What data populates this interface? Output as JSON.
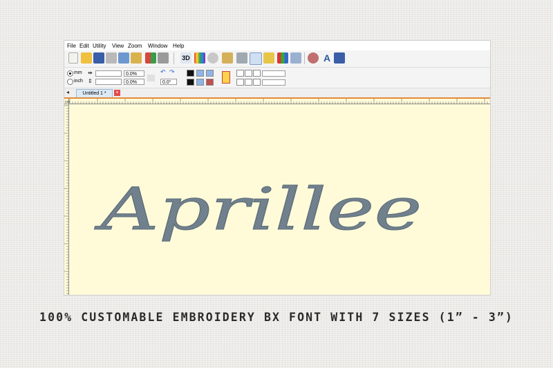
{
  "menu": [
    "File",
    "Edit",
    "Utility",
    "View",
    "Zoom",
    "Window",
    "Help"
  ],
  "toolbar": {
    "icons": [
      "new-icon",
      "open-icon",
      "save-icon",
      "print-icon",
      "copy-icon",
      "paste-icon",
      "mirror-icon",
      "arrange-icon",
      "3d-view-icon",
      "color-palette-icon",
      "zoom-icon",
      "ruler-icon",
      "plane-icon",
      "select-icon",
      "image-icon",
      "thread-colors-icon",
      "grid-icon",
      "settings-icon",
      "lettering-icon",
      "export-icon"
    ],
    "view3d_label": "3D",
    "lettering_label": "A"
  },
  "units": {
    "mm": "mm",
    "inch": "inch"
  },
  "fields": {
    "width_pct": "0.0%",
    "height_pct": "0.0%",
    "angle": "0.0°"
  },
  "tab": {
    "label": "Untitled 1 *",
    "close": "×",
    "nav": "◂"
  },
  "canvas": {
    "ruler_unit": "cm",
    "design_text": "Aprillee",
    "stitch_color": "#6f7f8c",
    "background": "#fffbd9"
  },
  "caption": "100% CUSTOMABLE EMBROIDERY BX FONT WITH 7 SIZES (1” -  3”)"
}
